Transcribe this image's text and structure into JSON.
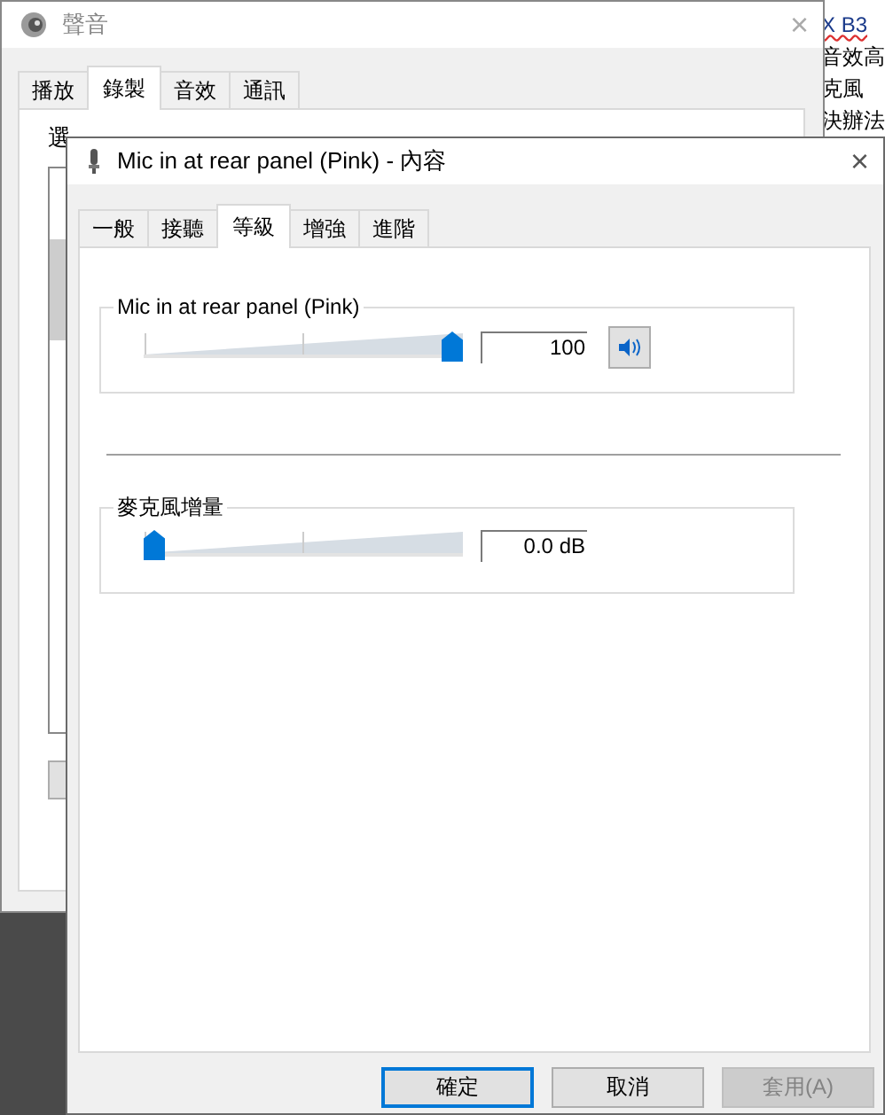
{
  "background_document": {
    "lines": [
      "X B3",
      "音效高",
      "克風",
      "決辦法"
    ]
  },
  "sound_window": {
    "title": "聲音",
    "close": "×",
    "tabs": [
      {
        "label": "播放",
        "selected": false
      },
      {
        "label": "錄製",
        "selected": true
      },
      {
        "label": "音效",
        "selected": false
      },
      {
        "label": "通訊",
        "selected": false
      }
    ],
    "instruction": "選"
  },
  "properties_window": {
    "title": "Mic in at rear panel (Pink) - 內容",
    "close": "×",
    "tabs": [
      {
        "label": "一般",
        "selected": false
      },
      {
        "label": "接聽",
        "selected": false
      },
      {
        "label": "等級",
        "selected": true
      },
      {
        "label": "增強",
        "selected": false
      },
      {
        "label": "進階",
        "selected": false
      }
    ],
    "levels": [
      {
        "kind": "volume",
        "label": "Mic in at rear panel (Pink)",
        "level": 1,
        "value": "100",
        "muted": false
      },
      {
        "kind": "boost",
        "label": "麥克風增量",
        "level": 0,
        "value": "0.0 dB"
      }
    ],
    "buttons": [
      {
        "label": "確定",
        "default": true,
        "disabled": false
      },
      {
        "label": "取消",
        "default": false,
        "disabled": false
      },
      {
        "label": "套用(A)",
        "default": false,
        "disabled": true
      }
    ]
  }
}
